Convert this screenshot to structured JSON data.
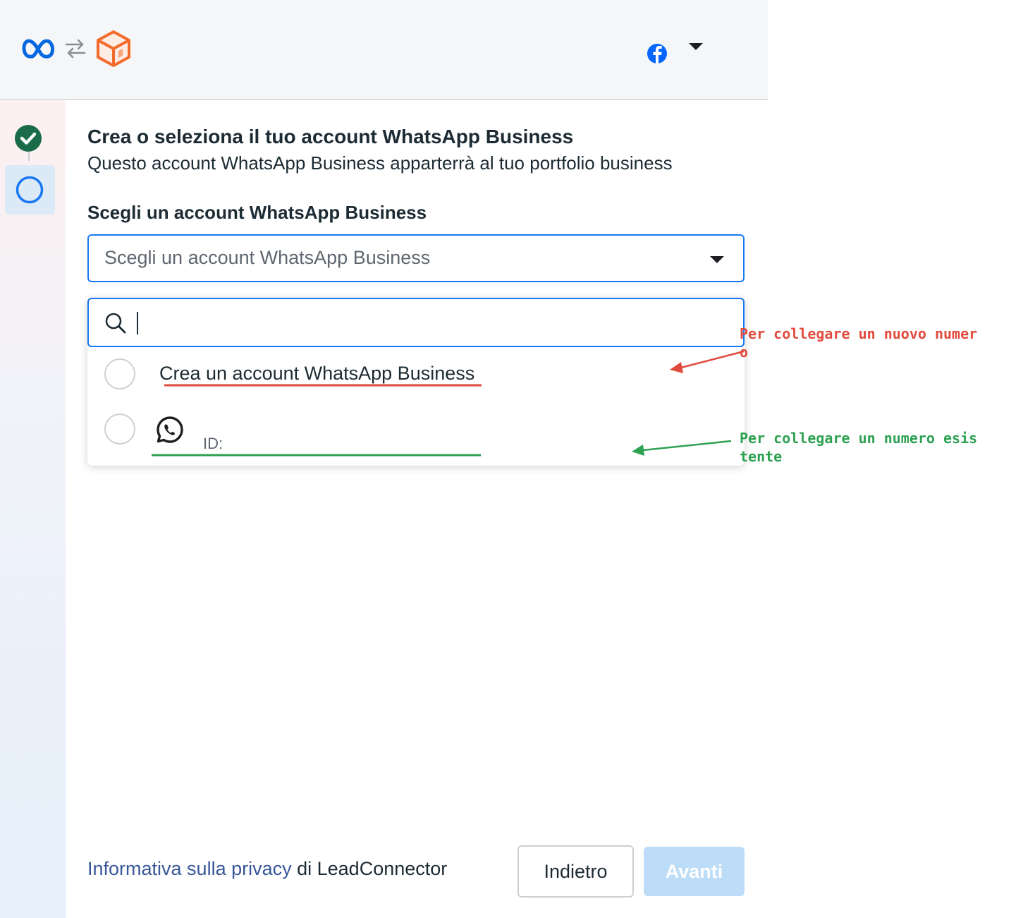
{
  "header": {
    "logos": [
      "meta-logo-icon",
      "swap-arrows-icon",
      "leadconnector-logo-icon"
    ],
    "account_icon": "facebook-icon",
    "account_caret": "caret-down-icon"
  },
  "stepper": {
    "steps": [
      {
        "status": "complete",
        "icon": "check-circle-icon"
      },
      {
        "status": "current",
        "icon": "circle-outline-icon"
      }
    ]
  },
  "main": {
    "title": "Crea o seleziona il tuo account WhatsApp Business",
    "subtitle": "Questo account WhatsApp Business apparterrà al tuo portfolio business",
    "field_label": "Scegli un account WhatsApp Business",
    "select": {
      "placeholder": "Scegli un account WhatsApp Business"
    },
    "dropdown": {
      "search_value": "",
      "options": [
        {
          "label": "Crea un account WhatsApp Business",
          "selected": false
        },
        {
          "icon": "whatsapp-icon",
          "id_label": "ID:",
          "selected": false
        }
      ]
    }
  },
  "footer": {
    "privacy_link": "Informativa sulla privacy",
    "privacy_suffix": " di LeadConnector",
    "back_label": "Indietro",
    "next_label": "Avanti"
  },
  "annotations": {
    "new_number": "Per collegare un nuovo numer\no",
    "existing_number": "Per collegare un numero esis\ntente"
  },
  "colors": {
    "accent": "#1877f2",
    "step_complete": "#1a6b47",
    "annotation_red": "#e14b3d",
    "annotation_green": "#2ea152",
    "next_disabled": "#bcdcf7"
  }
}
